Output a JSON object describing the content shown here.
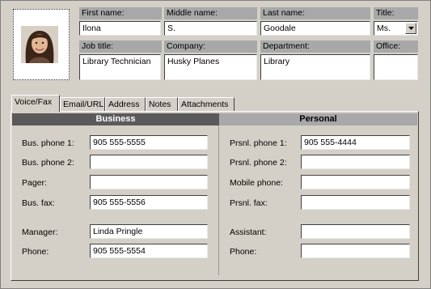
{
  "header": {
    "first_name": {
      "label": "First name:",
      "value": "Ilona"
    },
    "middle_name": {
      "label": "Middle name:",
      "value": "S."
    },
    "last_name": {
      "label": "Last name:",
      "value": "Goodale"
    },
    "title": {
      "label": "Title:",
      "value": "Ms."
    },
    "job_title": {
      "label": "Job title:",
      "value": "Library Technician"
    },
    "company": {
      "label": "Company:",
      "value": "Husky Planes"
    },
    "department": {
      "label": "Department:",
      "value": "Library"
    },
    "office": {
      "label": "Office:",
      "value": ""
    }
  },
  "tabs": [
    {
      "label": "Voice/Fax"
    },
    {
      "label": "Email/URL"
    },
    {
      "label": "Address"
    },
    {
      "label": "Notes"
    },
    {
      "label": "Attachments"
    }
  ],
  "business": {
    "heading": "Business",
    "fields": [
      {
        "label": "Bus. phone 1:",
        "value": "905 555-5555"
      },
      {
        "label": "Bus. phone 2:",
        "value": ""
      },
      {
        "label": "Pager:",
        "value": ""
      },
      {
        "label": "Bus. fax:",
        "value": "905 555-5556"
      },
      {
        "label": "Manager:",
        "value": "Linda Pringle"
      },
      {
        "label": "Phone:",
        "value": "905 555-5554"
      }
    ]
  },
  "personal": {
    "heading": "Personal",
    "fields": [
      {
        "label": "Prsnl. phone 1:",
        "value": "905 555-4444"
      },
      {
        "label": "Prsnl. phone 2:",
        "value": ""
      },
      {
        "label": "Mobile phone:",
        "value": ""
      },
      {
        "label": "Prsnl. fax:",
        "value": ""
      },
      {
        "label": "Assistant:",
        "value": ""
      },
      {
        "label": "Phone:",
        "value": ""
      }
    ]
  },
  "colors": {
    "business_header": "#5a5a5a",
    "business_header_text": "#ffffff",
    "personal_header": "#a8a8a8",
    "field_label_bg": "#a8a8a8",
    "window_bg": "#d4d0c8"
  },
  "icons": {
    "photo": "contact-photo",
    "dropdown": "chevron-down-icon"
  }
}
